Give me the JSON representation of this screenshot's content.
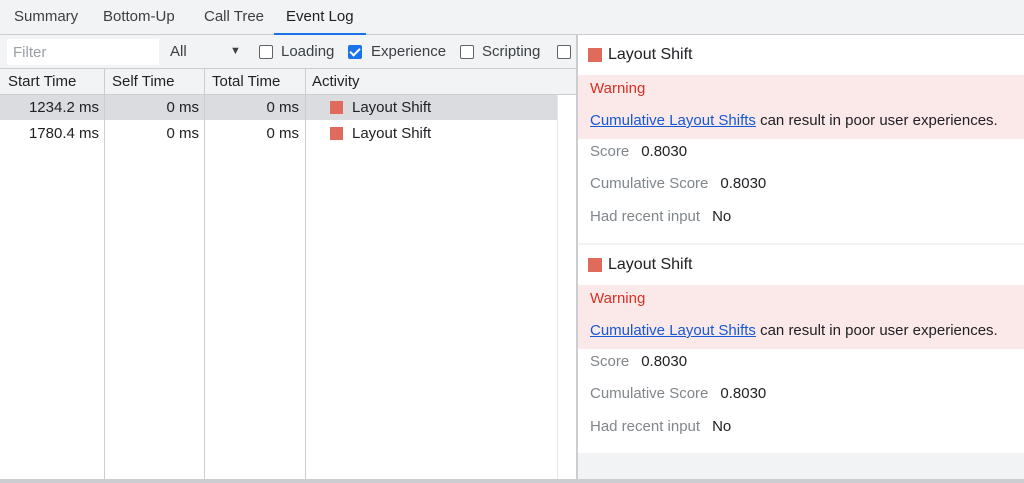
{
  "tabs": [
    {
      "label": "Summary"
    },
    {
      "label": "Bottom-Up"
    },
    {
      "label": "Call Tree"
    },
    {
      "label": "Event Log"
    }
  ],
  "toolbar": {
    "filter_placeholder": "Filter",
    "duration_select": "All",
    "checkboxes": [
      {
        "label": "Loading",
        "checked": false
      },
      {
        "label": "Experience",
        "checked": true
      },
      {
        "label": "Scripting",
        "checked": false
      },
      {
        "label": "",
        "checked": false
      }
    ]
  },
  "table": {
    "columns": [
      "Start Time",
      "Self Time",
      "Total Time",
      "Activity"
    ],
    "rows": [
      {
        "start": "1234.2 ms",
        "self": "0 ms",
        "total": "0 ms",
        "activity": "Layout Shift",
        "selected": true
      },
      {
        "start": "1780.4 ms",
        "self": "0 ms",
        "total": "0 ms",
        "activity": "Layout Shift",
        "selected": false
      }
    ]
  },
  "details": [
    {
      "title": "Layout Shift",
      "warning_label": "Warning",
      "warning_link": "Cumulative Layout Shifts",
      "warning_text": " can result in poor user experiences.",
      "score_label": "Score",
      "score_value": "0.8030",
      "cumulative_label": "Cumulative Score",
      "cumulative_value": "0.8030",
      "input_label": "Had recent input",
      "input_value": "No"
    },
    {
      "title": "Layout Shift",
      "warning_label": "Warning",
      "warning_link": "Cumulative Layout Shifts",
      "warning_text": " can result in poor user experiences.",
      "score_label": "Score",
      "score_value": "0.8030",
      "cumulative_label": "Cumulative Score",
      "cumulative_value": "0.8030",
      "input_label": "Had recent input",
      "input_value": "No"
    }
  ],
  "colors": {
    "layout_shift": "#e06b5c",
    "accent": "#1a73e8",
    "warning": "#d93025",
    "warning_bg": "#fbe9e9",
    "link": "#1558d6"
  },
  "icons": [
    "chevron-down-icon",
    "checkbox-icon",
    "layout-shift-swatch-icon"
  ]
}
